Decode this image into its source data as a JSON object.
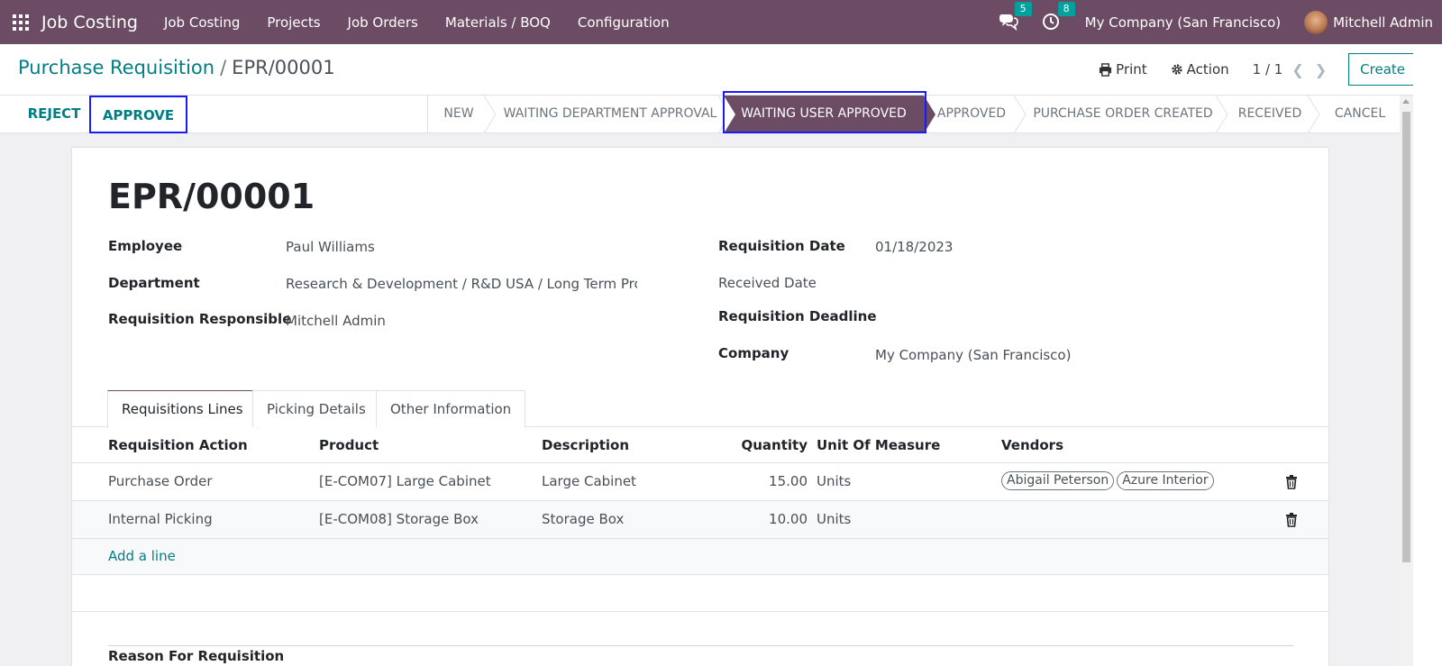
{
  "navbar": {
    "app_title": "Job Costing",
    "menu": [
      "Job Costing",
      "Projects",
      "Job Orders",
      "Materials / BOQ",
      "Configuration"
    ],
    "messages_count": "5",
    "activities_count": "8",
    "company": "My Company (San Francisco)",
    "user": "Mitchell Admin",
    "icons": [
      "apps-grid-icon",
      "chat-icon",
      "clock-icon",
      "avatar"
    ]
  },
  "breadcrumb": {
    "parent": "Purchase Requisition",
    "separator": "/",
    "current": "EPR/00001"
  },
  "control": {
    "print_label": "Print",
    "action_label": "Action",
    "pager": "1 / 1",
    "create_label": "Create"
  },
  "statusbar": {
    "reject_label": "REJECT",
    "approve_label": "APPROVE",
    "stages": [
      "NEW",
      "WAITING DEPARTMENT APPROVAL",
      "WAITING USER APPROVED",
      "APPROVED",
      "PURCHASE ORDER CREATED",
      "RECEIVED",
      "CANCEL"
    ],
    "active_stage": "WAITING USER APPROVED"
  },
  "form": {
    "title": "EPR/00001",
    "employee_label": "Employee",
    "employee": "Paul Williams",
    "department_label": "Department",
    "department": "Research & Development / R&D USA / Long Term Proje",
    "responsible_label": "Requisition Responsible",
    "responsible": "Mitchell Admin",
    "req_date_label": "Requisition Date",
    "req_date": "01/18/2023",
    "received_date_label": "Received Date",
    "deadline_label": "Requisition Deadline",
    "company_label": "Company",
    "company": "My Company (San Francisco)"
  },
  "tabs": [
    "Requisitions Lines",
    "Picking Details",
    "Other Information"
  ],
  "lines": {
    "headers": [
      "Requisition Action",
      "Product",
      "Description",
      "Quantity",
      "Unit Of Measure",
      "Vendors"
    ],
    "rows": [
      {
        "action": "Purchase Order",
        "product": "[E-COM07] Large Cabinet",
        "description": "Large Cabinet",
        "quantity": "15.00",
        "uom": "Units",
        "vendors": [
          "Abigail Peterson",
          "Azure Interior"
        ]
      },
      {
        "action": "Internal Picking",
        "product": "[E-COM08] Storage Box",
        "description": "Storage Box",
        "quantity": "10.00",
        "uom": "Units",
        "vendors": []
      }
    ],
    "add_line": "Add a line"
  },
  "reason_label": "Reason For Requisition",
  "colors": {
    "navbar": "#6c4b64",
    "accent": "#017e84",
    "highlight": "#1a1aff",
    "badge": "#00a09d"
  }
}
